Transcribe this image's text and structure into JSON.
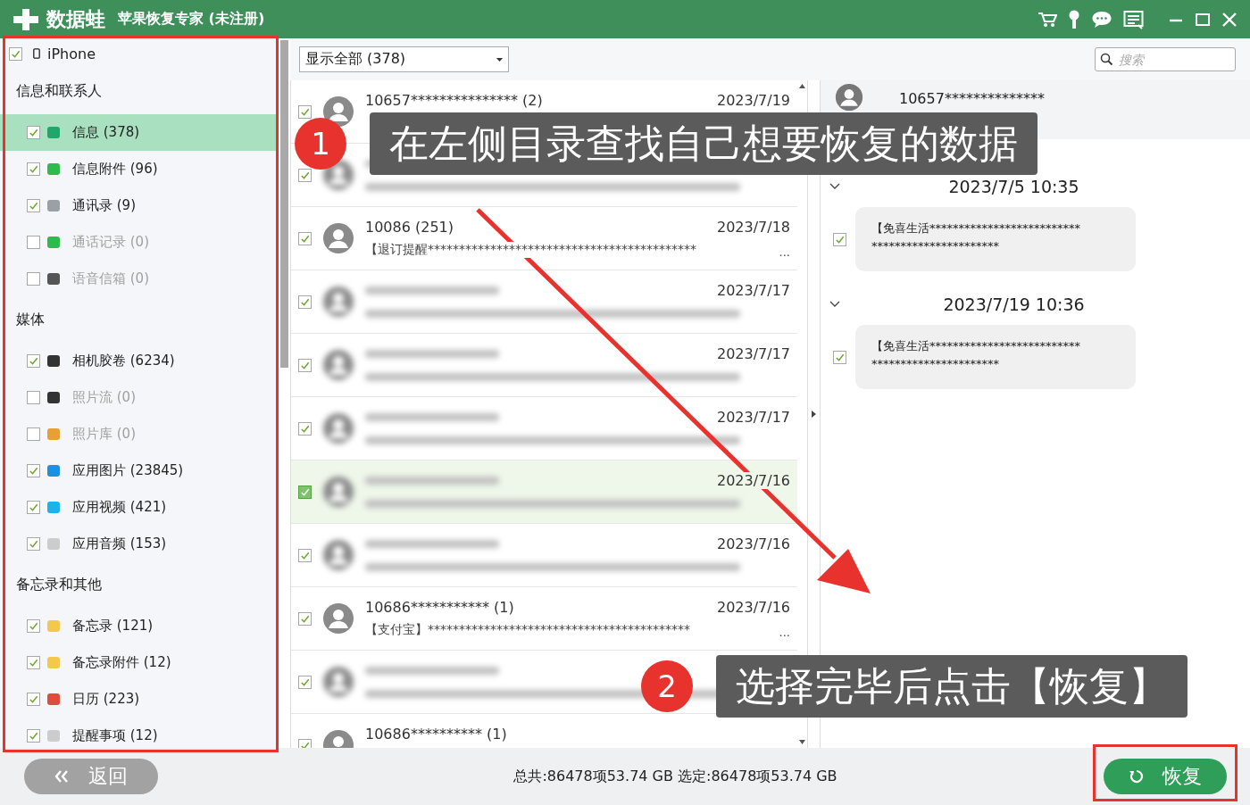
{
  "window": {
    "logo": "数据蛙",
    "title": "苹果恢复专家 (未注册)"
  },
  "sidebar": {
    "device": {
      "label": "iPhone",
      "checked": true
    },
    "groups": [
      {
        "heading": "信息和联系人",
        "items": [
          {
            "label": "信息 (378)",
            "checked": true,
            "disabled": false,
            "selected": true,
            "color": "#1fa86a"
          },
          {
            "label": "信息附件 (96)",
            "checked": true,
            "disabled": false,
            "selected": false,
            "color": "#2dbb4e"
          },
          {
            "label": "通讯录 (9)",
            "checked": true,
            "disabled": false,
            "selected": false,
            "color": "#9aa0a6"
          },
          {
            "label": "通话记录 (0)",
            "checked": false,
            "disabled": true,
            "selected": false,
            "color": "#2dbb4e"
          },
          {
            "label": "语音信箱 (0)",
            "checked": false,
            "disabled": true,
            "selected": false,
            "color": "#555555"
          }
        ]
      },
      {
        "heading": "媒体",
        "items": [
          {
            "label": "相机胶卷 (6234)",
            "checked": true,
            "disabled": false,
            "selected": false,
            "color": "#333333"
          },
          {
            "label": "照片流 (0)",
            "checked": false,
            "disabled": true,
            "selected": false,
            "color": "#333333"
          },
          {
            "label": "照片库 (0)",
            "checked": false,
            "disabled": true,
            "selected": false,
            "color": "#e5a136"
          },
          {
            "label": "应用图片 (23845)",
            "checked": true,
            "disabled": false,
            "selected": false,
            "color": "#1e90e0"
          },
          {
            "label": "应用视频 (421)",
            "checked": true,
            "disabled": false,
            "selected": false,
            "color": "#1ab3f0"
          },
          {
            "label": "应用音频 (153)",
            "checked": true,
            "disabled": false,
            "selected": false,
            "color": "#cccccc"
          }
        ]
      },
      {
        "heading": "备忘录和其他",
        "items": [
          {
            "label": "备忘录 (121)",
            "checked": true,
            "disabled": false,
            "selected": false,
            "color": "#f2c94c"
          },
          {
            "label": "备忘录附件 (12)",
            "checked": true,
            "disabled": false,
            "selected": false,
            "color": "#f2c94c"
          },
          {
            "label": "日历 (223)",
            "checked": true,
            "disabled": false,
            "selected": false,
            "color": "#e04c3c"
          },
          {
            "label": "提醒事项 (12)",
            "checked": true,
            "disabled": false,
            "selected": false,
            "color": "#cccccc"
          }
        ]
      }
    ]
  },
  "list": {
    "filter": "显示全部 (378)",
    "rows": [
      {
        "kind": "clear",
        "checked": true,
        "selected": false,
        "name": "10657***************",
        "count": "(2)",
        "date": "2023/7/19"
      },
      {
        "kind": "blurred",
        "checked": true,
        "selected": false
      },
      {
        "kind": "clear",
        "checked": true,
        "selected": false,
        "name": "10086",
        "count": "(251)",
        "date": "2023/7/18",
        "preview": "【退订提醒*******************************************",
        "ellipsis": "..."
      },
      {
        "kind": "blurred",
        "checked": true,
        "selected": false,
        "date": "2023/7/17"
      },
      {
        "kind": "blurred",
        "checked": true,
        "selected": false,
        "date": "2023/7/17"
      },
      {
        "kind": "blurred",
        "checked": true,
        "selected": false,
        "date": "2023/7/17"
      },
      {
        "kind": "blurred",
        "checked": true,
        "selected": true,
        "date": "2023/7/16"
      },
      {
        "kind": "blurred",
        "checked": true,
        "selected": false,
        "date": "2023/7/16"
      },
      {
        "kind": "clear",
        "checked": true,
        "selected": false,
        "name": "10686***********",
        "count": "(1)",
        "date": "2023/7/16",
        "preview": "【支付宝】******************************************",
        "ellipsis": "..."
      },
      {
        "kind": "blurred",
        "checked": true,
        "selected": false
      },
      {
        "kind": "clear",
        "checked": true,
        "selected": false,
        "name": "10686**********",
        "count": "(1)"
      }
    ]
  },
  "search": {
    "placeholder": "搜索"
  },
  "detail": {
    "contact": "10657**************",
    "messages": [
      {
        "time": "2023/7/5 10:35",
        "lines": [
          "【免喜生活**************************",
          "**********************"
        ],
        "checked": true,
        "expanded": true
      },
      {
        "time": "2023/7/19 10:36",
        "lines": [
          "【免喜生活**************************",
          "**********************"
        ],
        "checked": true,
        "expanded": true
      }
    ]
  },
  "footer": {
    "back": "返回",
    "summary": "总共:86478项53.74 GB 选定:86478项53.74 GB",
    "restore": "恢复"
  },
  "callouts": [
    {
      "number": "1",
      "text": "在左侧目录查找自己想要恢复的数据"
    },
    {
      "number": "2",
      "text": "选择完毕后点击【恢复】"
    }
  ]
}
